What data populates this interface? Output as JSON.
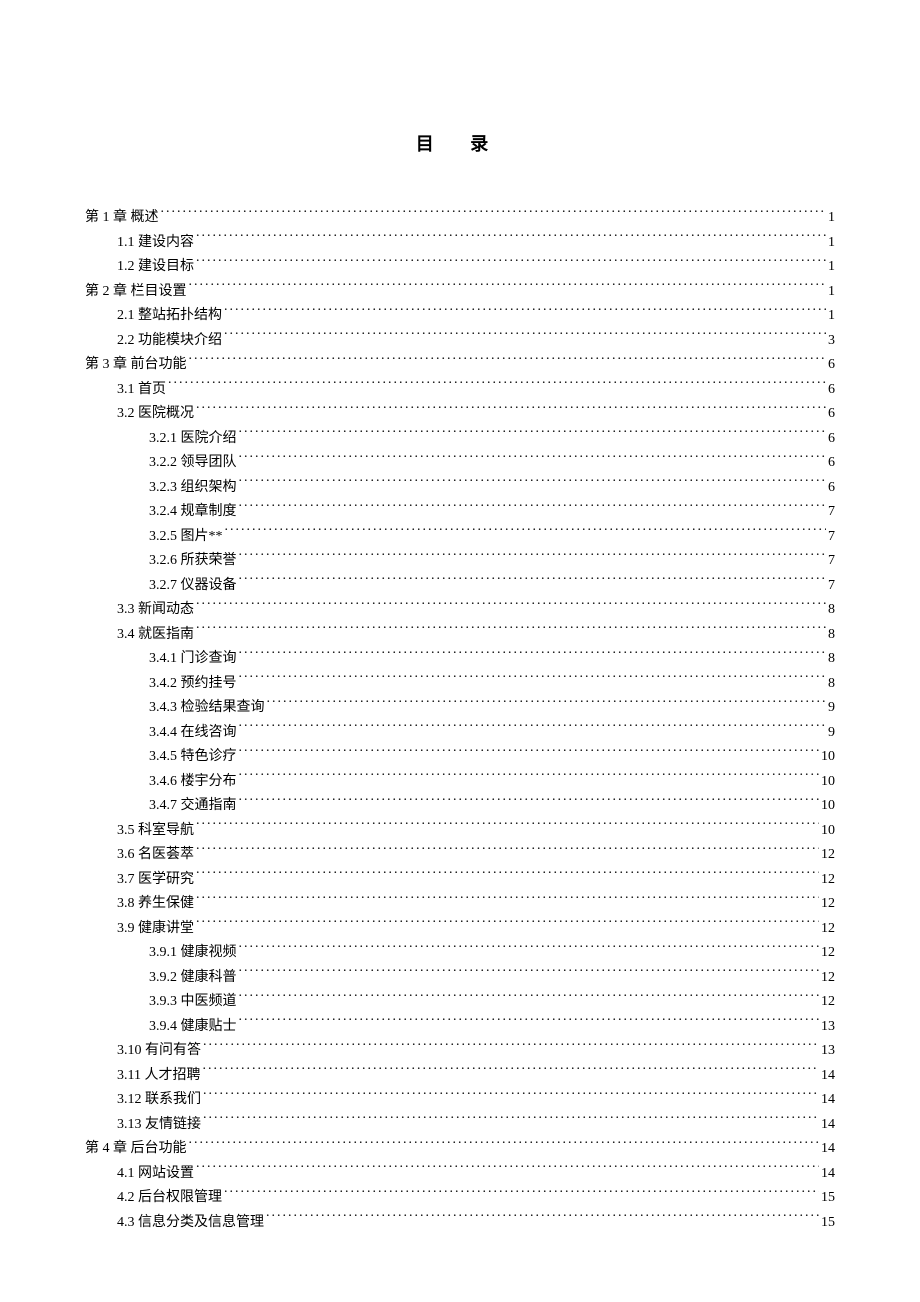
{
  "title": "目 录",
  "entries": [
    {
      "level": 0,
      "label": "第 1 章 概述",
      "page": "1"
    },
    {
      "level": 1,
      "label": "1.1 建设内容",
      "page": "1"
    },
    {
      "level": 1,
      "label": "1.2 建设目标",
      "page": "1"
    },
    {
      "level": 0,
      "label": "第 2 章 栏目设置",
      "page": "1"
    },
    {
      "level": 1,
      "label": "2.1 整站拓扑结构",
      "page": "1"
    },
    {
      "level": 1,
      "label": "2.2 功能模块介绍",
      "page": "3"
    },
    {
      "level": 0,
      "label": "第 3 章 前台功能",
      "page": "6"
    },
    {
      "level": 1,
      "label": "3.1 首页",
      "page": "6"
    },
    {
      "level": 1,
      "label": "3.2 医院概况",
      "page": "6"
    },
    {
      "level": 2,
      "label": "3.2.1 医院介绍",
      "page": "6"
    },
    {
      "level": 2,
      "label": "3.2.2 领导团队",
      "page": "6"
    },
    {
      "level": 2,
      "label": "3.2.3 组织架构",
      "page": "6"
    },
    {
      "level": 2,
      "label": "3.2.4 规章制度",
      "page": "7"
    },
    {
      "level": 2,
      "label": "3.2.5 图片**",
      "page": "7"
    },
    {
      "level": 2,
      "label": "3.2.6 所获荣誉",
      "page": "7"
    },
    {
      "level": 2,
      "label": "3.2.7 仪器设备",
      "page": "7"
    },
    {
      "level": 1,
      "label": "3.3 新闻动态",
      "page": "8"
    },
    {
      "level": 1,
      "label": "3.4 就医指南",
      "page": "8"
    },
    {
      "level": 2,
      "label": "3.4.1 门诊查询",
      "page": "8"
    },
    {
      "level": 2,
      "label": "3.4.2 预约挂号",
      "page": "8"
    },
    {
      "level": 2,
      "label": "3.4.3 检验结果查询",
      "page": "9"
    },
    {
      "level": 2,
      "label": "3.4.4 在线咨询",
      "page": "9"
    },
    {
      "level": 2,
      "label": "3.4.5 特色诊疗",
      "page": "10"
    },
    {
      "level": 2,
      "label": "3.4.6 楼宇分布",
      "page": "10"
    },
    {
      "level": 2,
      "label": "3.4.7 交通指南",
      "page": "10"
    },
    {
      "level": 1,
      "label": "3.5 科室导航",
      "page": "10"
    },
    {
      "level": 1,
      "label": "3.6 名医荟萃",
      "page": "12"
    },
    {
      "level": 1,
      "label": "3.7 医学研究",
      "page": "12"
    },
    {
      "level": 1,
      "label": "3.8 养生保健",
      "page": "12"
    },
    {
      "level": 1,
      "label": "3.9 健康讲堂",
      "page": "12"
    },
    {
      "level": 2,
      "label": "3.9.1 健康视频",
      "page": "12"
    },
    {
      "level": 2,
      "label": "3.9.2 健康科普",
      "page": "12"
    },
    {
      "level": 2,
      "label": "3.9.3 中医频道",
      "page": "12"
    },
    {
      "level": 2,
      "label": "3.9.4 健康贴士",
      "page": "13"
    },
    {
      "level": 1,
      "label": "3.10 有问有答",
      "page": "13"
    },
    {
      "level": 1,
      "label": "3.11 人才招聘",
      "page": "14"
    },
    {
      "level": 1,
      "label": "3.12 联系我们",
      "page": "14"
    },
    {
      "level": 1,
      "label": "3.13 友情链接",
      "page": "14"
    },
    {
      "level": 0,
      "label": "第 4 章 后台功能",
      "page": "14"
    },
    {
      "level": 1,
      "label": "4.1 网站设置",
      "page": "14"
    },
    {
      "level": 1,
      "label": "4.2 后台权限管理",
      "page": "15"
    },
    {
      "level": 1,
      "label": "4.3 信息分类及信息管理",
      "page": "15"
    }
  ]
}
